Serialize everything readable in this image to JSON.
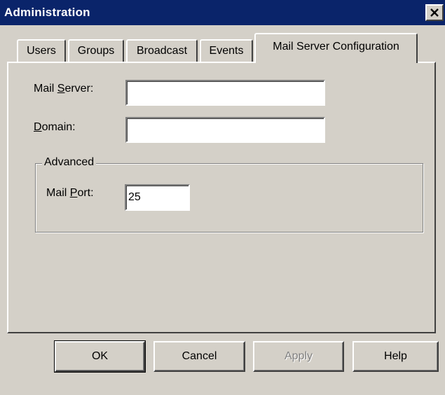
{
  "window": {
    "title": "Administration"
  },
  "tabs": [
    {
      "label": "Users"
    },
    {
      "label": "Groups"
    },
    {
      "label": "Broadcast"
    },
    {
      "label": "Events"
    },
    {
      "label": "Mail Server Configuration",
      "active": true
    }
  ],
  "form": {
    "mail_server": {
      "label_prefix": "Mail ",
      "label_mnemonic": "S",
      "label_suffix": "erver:",
      "value": ""
    },
    "domain": {
      "label_mnemonic": "D",
      "label_suffix": "omain:",
      "value": ""
    },
    "advanced": {
      "legend": "Advanced",
      "mail_port": {
        "label_prefix": "Mail ",
        "label_mnemonic": "P",
        "label_suffix": "ort:",
        "value": "25"
      }
    }
  },
  "buttons": {
    "ok": "OK",
    "cancel": "Cancel",
    "apply": "Apply",
    "help": "Help"
  }
}
